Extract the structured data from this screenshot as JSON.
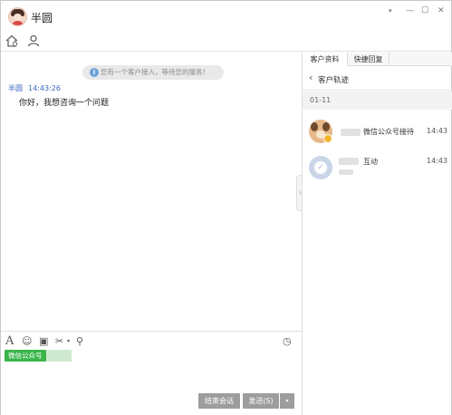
{
  "window": {
    "title": "半圆",
    "controls": {
      "dropdown": "▾",
      "minimize": "—",
      "maximize": "☐",
      "close": "✕"
    }
  },
  "chat": {
    "system_message": "您有一个客户接入，等待您的服务！",
    "system_icon": "i",
    "messages": [
      {
        "sender": "半圆",
        "time": "14:43:26",
        "text": "你好，我想咨询一个问题"
      }
    ],
    "collapse_glyph": "›"
  },
  "input": {
    "tools": {
      "font": "A",
      "emoji": "☺",
      "image": "▣",
      "cut": "✂",
      "cut_dropdown": "▾",
      "contact": "⚲",
      "history": "◷"
    },
    "tag": "微信公众号",
    "end_label": "结束会话",
    "send_label": "发送(S)",
    "send_dropdown": "▾"
  },
  "right_pane": {
    "tabs": [
      "客户资料",
      "快捷回复"
    ],
    "back_glyph": "‹",
    "back_label": "客户轨迹",
    "date": "01-11",
    "tracks": [
      {
        "text": "微信公众号接待",
        "time": "14:43"
      },
      {
        "text": "互动",
        "time": "14:43"
      }
    ]
  },
  "colors": {
    "tag_green": "#3ab54a",
    "sender_blue": "#3a66c4",
    "button_gray": "#9d9d9d"
  },
  "icons": [
    "home-icon",
    "user-icon",
    "info-icon",
    "font-icon",
    "emoji-icon",
    "image-icon",
    "scissors-icon",
    "contact-icon",
    "history-icon"
  ]
}
